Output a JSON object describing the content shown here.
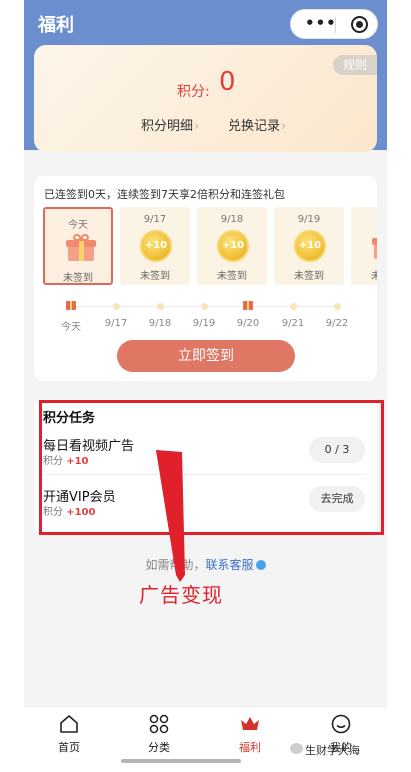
{
  "header": {
    "title": "福利",
    "more_icon": "more-dots-icon",
    "close_icon": "target-circle-icon"
  },
  "points": {
    "rule_label": "规则",
    "label": "积分:",
    "value": "0",
    "detail_link": "积分明细",
    "record_link": "兑换记录"
  },
  "checkin": {
    "streak_text": "已连签到0天，连续签到7天享2倍积分和连签礼包",
    "days": [
      {
        "date": "今天",
        "status": "未签到",
        "reward": "gift"
      },
      {
        "date": "9/17",
        "status": "未签到",
        "reward": "+10"
      },
      {
        "date": "9/18",
        "status": "未签到",
        "reward": "+10"
      },
      {
        "date": "9/19",
        "status": "未签到",
        "reward": "+10"
      },
      {
        "date": "",
        "status": "未",
        "reward": "gift"
      }
    ],
    "timeline": [
      {
        "label": "今天",
        "marker": "gift"
      },
      {
        "label": "9/17",
        "marker": "dot"
      },
      {
        "label": "9/18",
        "marker": "dot"
      },
      {
        "label": "9/19",
        "marker": "dot"
      },
      {
        "label": "9/20",
        "marker": "gift"
      },
      {
        "label": "9/21",
        "marker": "dot"
      },
      {
        "label": "9/22",
        "marker": "dot"
      }
    ],
    "button_label": "立即签到"
  },
  "tasks": {
    "title": "积分任务",
    "items": [
      {
        "name": "每日看视频广告",
        "points_label": "积分",
        "points": "+10",
        "action": "0 / 3"
      },
      {
        "name": "开通VIP会员",
        "points_label": "积分",
        "points": "+100",
        "action": "去完成"
      }
    ]
  },
  "help": {
    "prefix": "如需帮助，",
    "link": "联系客服"
  },
  "annotation": "广告变现",
  "tabbar": [
    {
      "label": "首页",
      "icon": "home-icon"
    },
    {
      "label": "分类",
      "icon": "grid-icon"
    },
    {
      "label": "福利",
      "icon": "crown-icon",
      "active": true
    },
    {
      "label": "我的",
      "icon": "smile-face-icon"
    }
  ],
  "watermark": "生财学大海",
  "colors": {
    "brand_blue": "#6b8fce",
    "accent_red": "#e33e3e",
    "button_coral": "#e07664",
    "frame_red": "#e0202a"
  }
}
